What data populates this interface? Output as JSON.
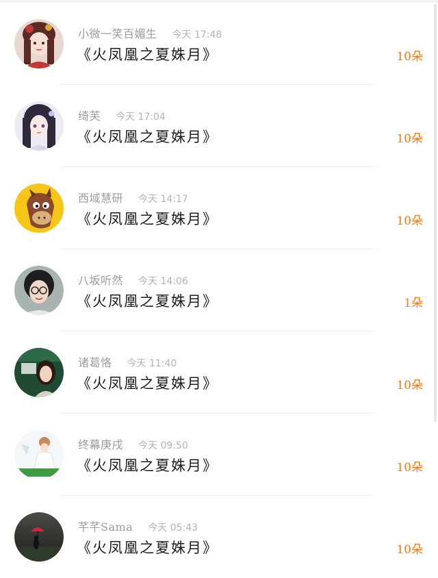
{
  "list": {
    "items": [
      {
        "name": "小微一笑百媚生",
        "time": "今天 17:48",
        "title": "《火凤凰之夏姝月》",
        "count": "10朵",
        "avatar_icon": "avatar-anime-girl-red"
      },
      {
        "name": "绮芙",
        "time": "今天 17:04",
        "title": "《火凤凰之夏姝月》",
        "count": "10朵",
        "avatar_icon": "avatar-anime-girl-dark-hair"
      },
      {
        "name": "西域慧研",
        "time": "今天 14:17",
        "title": "《火凤凰之夏姝月》",
        "count": "10朵",
        "avatar_icon": "avatar-cartoon-horse"
      },
      {
        "name": "八坂听然",
        "time": "今天 14:06",
        "title": "《火凤凰之夏姝月》",
        "count": "1朵",
        "avatar_icon": "avatar-girl-glasses"
      },
      {
        "name": "诸葛恪",
        "time": "今天 11:40",
        "title": "《火凤凰之夏姝月》",
        "count": "10朵",
        "avatar_icon": "avatar-photo-woman"
      },
      {
        "name": "终幕庚戌",
        "time": "今天 09:50",
        "title": "《火凤凰之夏姝月》",
        "count": "10朵",
        "avatar_icon": "avatar-bride-illustration"
      },
      {
        "name": "芊芊Sama",
        "time": "今天 05:43",
        "title": "《火凤凰之夏姝月》",
        "count": "10朵",
        "avatar_icon": "avatar-umbrella-silhouette"
      }
    ]
  },
  "colors": {
    "accent": "#f07a1c",
    "name_text": "#9b9b9b",
    "title_text": "#1c1c1c"
  }
}
